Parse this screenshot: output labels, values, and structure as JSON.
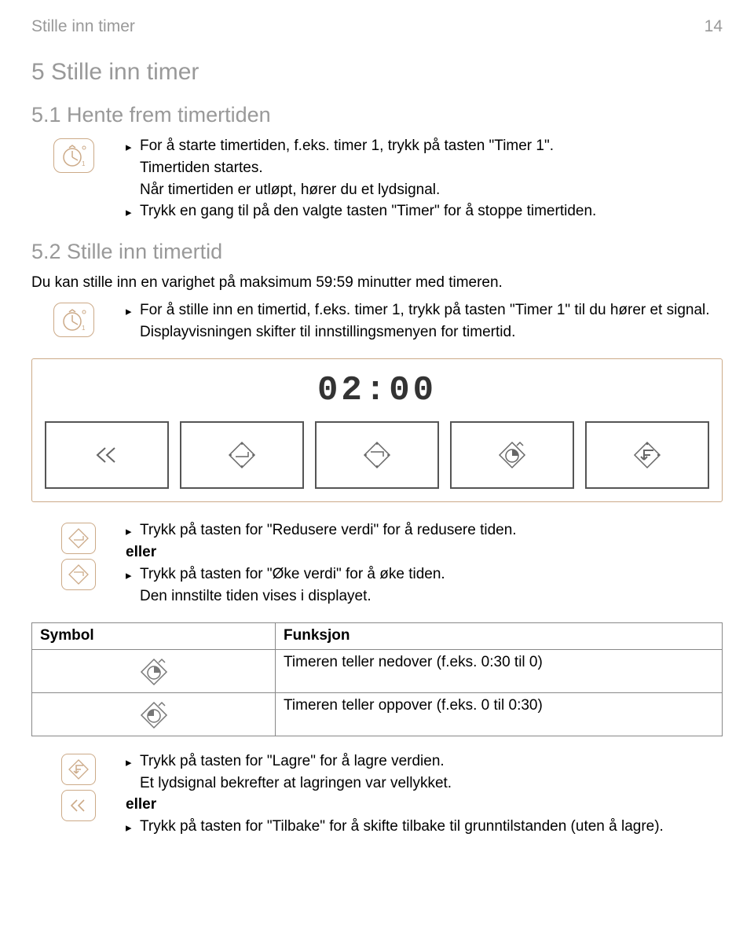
{
  "header": {
    "left": "Stille inn timer",
    "page": "14"
  },
  "h1": "5  Stille inn timer",
  "s51": {
    "title": "5.1  Hente frem timertiden",
    "b1": "For å starte timertiden, f.eks. timer 1, trykk på tasten \"Timer 1\".",
    "l1": "Timertiden startes.",
    "l2": "Når timertiden er utløpt, hører du et lydsignal.",
    "b2": "Trykk en gang til på den valgte tasten \"Timer\" for å stoppe timertiden."
  },
  "s52": {
    "title": "5.2  Stille inn timertid",
    "intro": "Du kan stille inn en varighet på maksimum 59:59 minutter med timeren.",
    "b1": "For å stille inn en timertid, f.eks. timer 1, trykk på tasten \"Timer 1\" til du hører et signal.",
    "l1": "Displayvisningen skifter til innstillingsmenyen for timertid."
  },
  "display": {
    "time": "02:00"
  },
  "reduce": {
    "b1": "Trykk på tasten for \"Redusere verdi\" for å redusere tiden.",
    "or": "eller",
    "b2": "Trykk på tasten for \"Øke verdi\" for å øke tiden.",
    "l1": "Den innstilte tiden vises i displayet."
  },
  "table": {
    "h1": "Symbol",
    "h2": "Funksjon",
    "r1": "Timeren teller nedover (f.eks. 0:30 til 0)",
    "r2": "Timeren teller oppover (f.eks. 0 til 0:30)"
  },
  "save": {
    "b1": "Trykk på tasten for \"Lagre\" for å lagre verdien.",
    "l1": "Et lydsignal bekrefter at lagringen var vellykket.",
    "or": "eller",
    "b2": "Trykk på tasten for \"Tilbake\" for å skifte tilbake til grunntilstanden (uten å lagre)."
  }
}
